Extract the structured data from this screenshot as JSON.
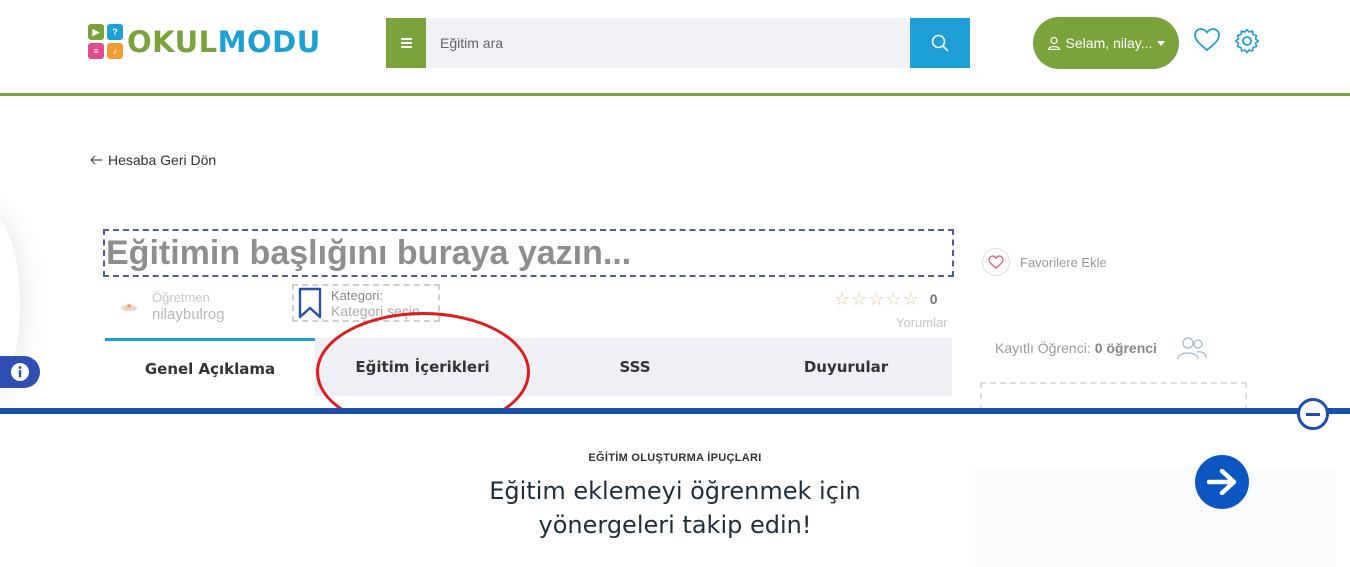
{
  "header": {
    "logo": {
      "text_a": "OKUL",
      "text_b": "MODU",
      "tile_glyphs": [
        "▶",
        "?",
        "≡",
        "♪"
      ],
      "tile_colors": [
        "#7aa33c",
        "#1e9fd6",
        "#e14b8a",
        "#f39c32"
      ]
    },
    "search": {
      "placeholder": "Eğitim ara",
      "menu_icon": "menu-icon",
      "button_icon": "search-icon"
    },
    "user": {
      "label": "Selam, nilay...",
      "icon": "user-icon"
    },
    "icons": [
      "heart-icon",
      "gear-icon"
    ]
  },
  "back_link": "Hesaba Geri Dön",
  "course": {
    "title_placeholder": "Eğitimin başlığını buraya yazın...",
    "teacher_label": "Öğretmen",
    "teacher_name": "nilaybulrog",
    "category_label": "Kategori:",
    "category_value": "Kategori seçin",
    "rating": {
      "stars": 5,
      "filled": 0,
      "count": "0",
      "reviews_label": "Yorumlar"
    }
  },
  "tabs": [
    {
      "label": "Genel Açıklama",
      "active": true
    },
    {
      "label": "Eğitim İçerikleri",
      "active": false
    },
    {
      "label": "SSS",
      "active": false
    },
    {
      "label": "Duyurular",
      "active": false
    }
  ],
  "sidebar": {
    "favorite_label": "Favorilere Ekle",
    "students_label": "Kayıtlı Öğrenci:",
    "students_value": "0 öğrenci"
  },
  "tips": {
    "label": "EĞİTİM OLUŞTURMA İPUÇLARI",
    "text": "Eğitim eklemeyi öğrenmek için yönergeleri takip edin!"
  },
  "colors": {
    "brand_green": "#7aa33c",
    "brand_blue": "#1e9fd6",
    "tips_blue": "#1a4fad",
    "annotation_red": "#e01b1b"
  }
}
